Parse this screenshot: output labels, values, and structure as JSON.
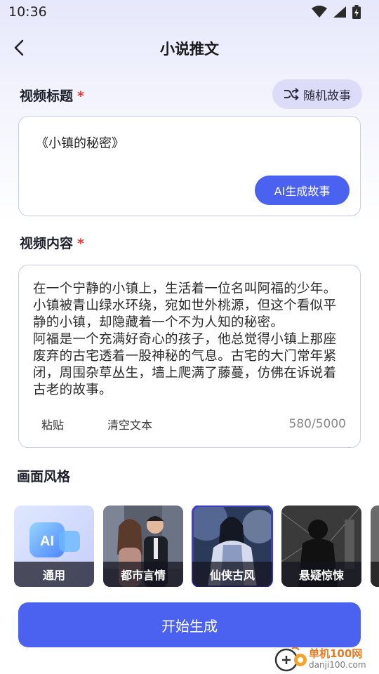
{
  "status": {
    "time": "10:36"
  },
  "nav": {
    "title": "小说推文"
  },
  "title_section": {
    "label": "视频标题",
    "required_mark": "*",
    "random_label": "随机故事",
    "value": "《小镇的秘密》",
    "ai_button_label": "AI生成故事"
  },
  "content_section": {
    "label": "视频内容",
    "required_mark": "*",
    "text": "在一个宁静的小镇上，生活着一位名叫阿福的少年。小镇被青山绿水环绕，宛如世外桃源，但这个看似平静的小镇，却隐藏着一个不为人知的秘密。\n阿福是一个充满好奇心的孩子，他总觉得小镇上那座废弃的古宅透着一股神秘的气息。古宅的大门常年紧闭，周围杂草丛生，墙上爬满了藤蔓，仿佛在诉说着古老的故事。",
    "paste_label": "粘贴",
    "clear_label": "清空文本",
    "char_count": "580/5000"
  },
  "style_section": {
    "label": "画面风格",
    "items": [
      {
        "label": "通用",
        "selected": false
      },
      {
        "label": "都市言情",
        "selected": false
      },
      {
        "label": "仙侠古风",
        "selected": true
      },
      {
        "label": "悬疑惊悚",
        "selected": false
      }
    ]
  },
  "start_button_label": "开始生成",
  "watermark": {
    "line1": "单机100网",
    "line2": "danji100.com"
  },
  "colors": {
    "accent": "#4b61f0",
    "required": "#e6383a",
    "chip_bg": "#dcdcf8"
  }
}
